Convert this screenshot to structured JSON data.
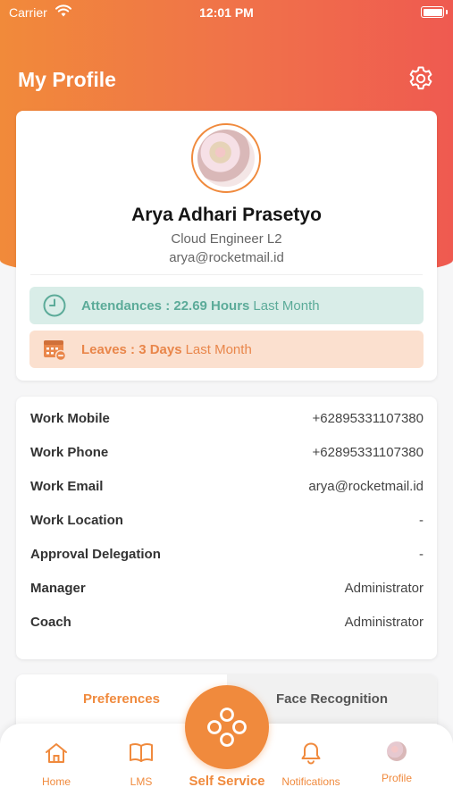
{
  "status_bar": {
    "carrier": "Carrier",
    "time": "12:01 PM"
  },
  "header": {
    "title": "My Profile",
    "settings_icon": "gear-icon"
  },
  "profile": {
    "name": "Arya Adhari Prasetyo",
    "role": "Cloud Engineer L2",
    "email": "arya@rocketmail.id",
    "attendance": {
      "label": "Attendances : 22.69 Hours",
      "period": "Last Month",
      "icon": "clock-icon",
      "color": "#5cab99"
    },
    "leaves": {
      "label": "Leaves : 3 Days",
      "period": "Last Month",
      "icon": "calendar-icon",
      "color": "#e9864a"
    }
  },
  "info": {
    "rows": [
      {
        "label": "Work Mobile",
        "value": "+62895331107380"
      },
      {
        "label": "Work Phone",
        "value": "+62895331107380"
      },
      {
        "label": "Work Email",
        "value": "arya@rocketmail.id"
      },
      {
        "label": "Work Location",
        "value": "-"
      },
      {
        "label": "Approval Delegation",
        "value": "-"
      },
      {
        "label": "Manager",
        "value": "Administrator"
      },
      {
        "label": "Coach",
        "value": "Administrator"
      }
    ]
  },
  "tabs": [
    {
      "label": "Preferences",
      "active": true
    },
    {
      "label": "Face Recognition",
      "active": false
    }
  ],
  "nav": {
    "home": "Home",
    "lms": "LMS",
    "self_service": "Self Service",
    "notifications": "Notifications",
    "profile": "Profile"
  },
  "colors": {
    "accent": "#f08a3d",
    "header_start": "#f18a3a",
    "header_end": "#ef5a50"
  }
}
